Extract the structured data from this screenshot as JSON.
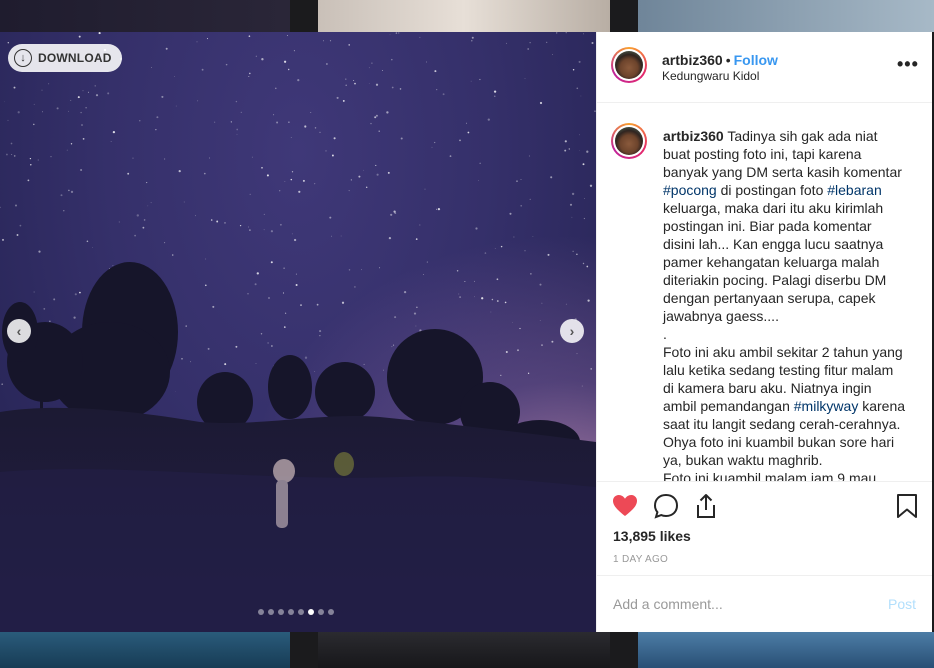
{
  "photo": {
    "download_label": "DOWNLOAD",
    "carousel_total": 8,
    "carousel_active_index": 5
  },
  "post": {
    "username": "artbiz360",
    "follow_label": "Follow",
    "separator": "•",
    "location": "Kedungwaru Kidol",
    "more_label": "•••",
    "caption_segments": [
      {
        "t": "Tadinya sih gak ada niat buat posting foto ini, tapi karena banyak yang DM serta kasih komentar ",
        "tag": false
      },
      {
        "t": "#pocong",
        "tag": true
      },
      {
        "t": " di postingan foto ",
        "tag": false
      },
      {
        "t": "#lebaran",
        "tag": true
      },
      {
        "t": " keluarga, maka dari itu aku kirimlah postingan ini. Biar pada komentar disini lah... Kan engga lucu saatnya pamer kehangatan keluarga malah diteriakin pocing. Palagi diserbu DM dengan pertanyaan serupa, capek jawabnya gaess....\n.\nFoto ini aku ambil sekitar 2 tahun yang lalu ketika sedang testing fitur malam di kamera baru aku. Niatnya ingin ambil pemandangan ",
        "tag": false
      },
      {
        "t": "#milkyway",
        "tag": true
      },
      {
        "t": " karena saat itu langit sedang cerah-cerahnya. Ohya foto ini kuambil bukan sore hari ya, bukan waktu maghrib.\nFoto ini kuambil malam jam 9 mau",
        "tag": false
      }
    ],
    "likes": "13,895 likes",
    "timestamp": "1 DAY AGO",
    "comment_placeholder": "Add a comment...",
    "post_label": "Post"
  },
  "colors": {
    "link": "#3897f0",
    "hashtag": "#003569",
    "liked_heart": "#ed4956",
    "post_disabled": "#b2dffc"
  }
}
